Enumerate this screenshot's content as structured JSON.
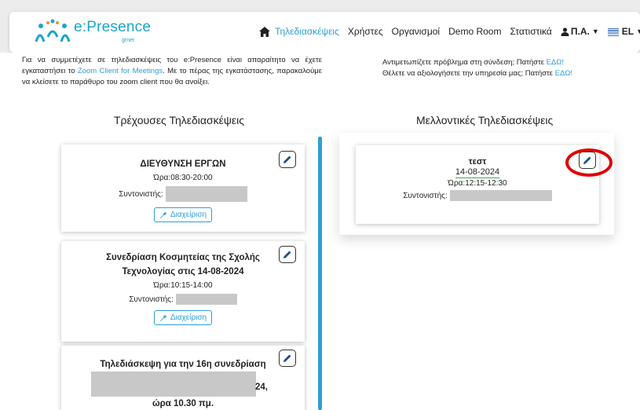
{
  "nav": {
    "logo": "e:Presence",
    "logo_sub": "grnet",
    "items": [
      {
        "label": "Τηλεδιασκέψεις"
      },
      {
        "label": "Χρήστες"
      },
      {
        "label": "Οργανισμοί"
      },
      {
        "label": "Demo Room"
      },
      {
        "label": "Στατιστικά"
      }
    ],
    "user": "Π.Α.",
    "lang": "EL"
  },
  "info": {
    "left_1": "Για να συμμετέχετε σε τηλεδιασκέψεις του e:Presence είναι απαραίτητο να έχετε εγκαταστήσει το ",
    "left_link": "Zoom Client for Meetings",
    "left_2": ". Με το πέρας της εγκατάστασης, παρακαλούμε να κλείσετε το παράθυρο του zoom client που θα ανοίξει.",
    "right_1": "Αντιμετωπίζετε πρόβλημα στη σύνδεση; Πατήστε ",
    "right_link_1": "ΕΔΩ!",
    "right_2": "Θέλετε να αξιολογήσετε την υπηρεσία μας; Πατήστε ",
    "right_link_2": "ΕΔΩ!"
  },
  "current": {
    "title": "Τρέχουσες Τηλεδιασκέψεις",
    "coord_label": "Συντονιστής:",
    "manage_label": "Διαχείριση",
    "cards": [
      {
        "title": "ΔΙΕΥΘΥΝΣΗ ΕΡΓΩΝ",
        "hours": "Ώρα:08:30-20:00"
      },
      {
        "title": "Συνεδρίαση Κοσμητείας της Σχολής Τεχνολογίας στις 14-08-2024",
        "hours": "Ώρα:10:15-14:00"
      },
      {
        "title_1": "Τηλεδιάσκεψη για την 16η συνεδρίαση",
        "title_2": "24,",
        "title_3": "ώρα 10.30 πμ."
      }
    ]
  },
  "upcoming": {
    "title": "Μελλοντικές Τηλεδιασκέψεις",
    "card": {
      "title": "τεστ",
      "date": "14-08-2024",
      "hours": "Ώρα:12:15-12:30",
      "coord_label": "Συντονιστής:"
    }
  },
  "colors": {
    "accent": "#2b9fd8",
    "highlight": "#e00000"
  },
  "icons": [
    "home-icon",
    "user-icon",
    "flag-icon",
    "pencil-icon",
    "wrench-icon",
    "chevron-down-icon"
  ]
}
